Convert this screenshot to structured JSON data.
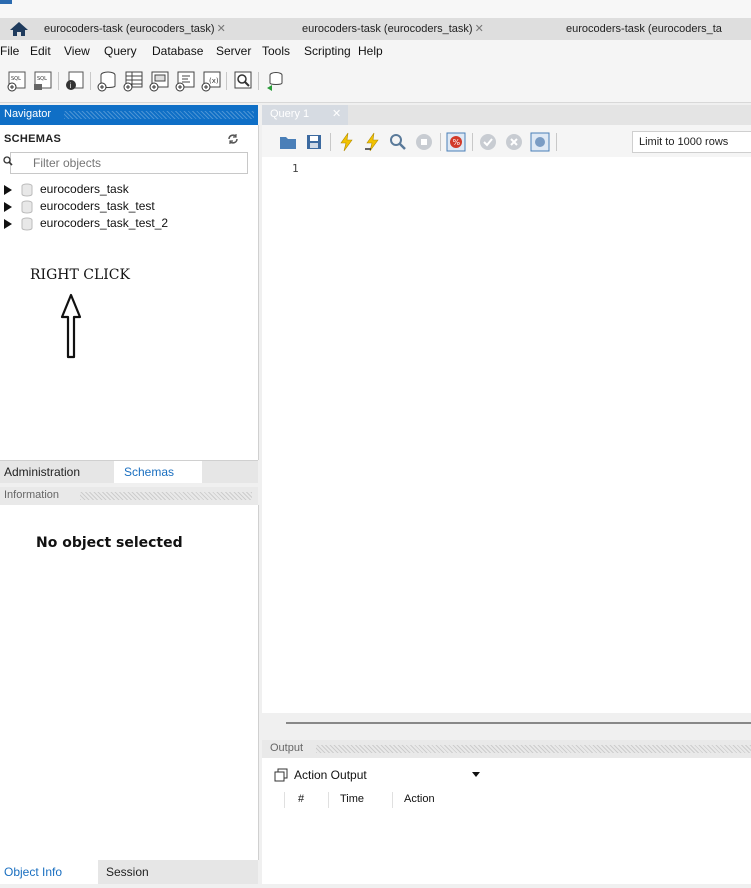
{
  "tabs": [
    {
      "label": "eurocoders-task (eurocoders_task)"
    },
    {
      "label": "eurocoders-task (eurocoders_task)"
    },
    {
      "label": "eurocoders-task (eurocoders_ta"
    }
  ],
  "menu": [
    "File",
    "Edit",
    "View",
    "Query",
    "Database",
    "Server",
    "Tools",
    "Scripting",
    "Help"
  ],
  "navigator": {
    "title": "Navigator",
    "schemas_label": "SCHEMAS",
    "filter_placeholder": "Filter objects",
    "schemas": [
      "eurocoders_task",
      "eurocoders_task_test",
      "eurocoders_task_test_2"
    ]
  },
  "annotation": {
    "text": "RIGHT CLICK"
  },
  "nav_tabs": {
    "administration": "Administration",
    "schemas": "Schemas"
  },
  "information": {
    "title": "Information",
    "empty_text": "No object selected"
  },
  "info_tabs": {
    "object_info": "Object Info",
    "session": "Session"
  },
  "query": {
    "tab_label": "Query 1",
    "limit_label": "Limit to 1000 rows",
    "line_number": "1"
  },
  "output": {
    "title": "Output",
    "selected": "Action Output",
    "columns": [
      "#",
      "Time",
      "Action"
    ]
  },
  "colors": {
    "accent": "#0f6fc6",
    "tab_active": "#d6dbe2"
  }
}
